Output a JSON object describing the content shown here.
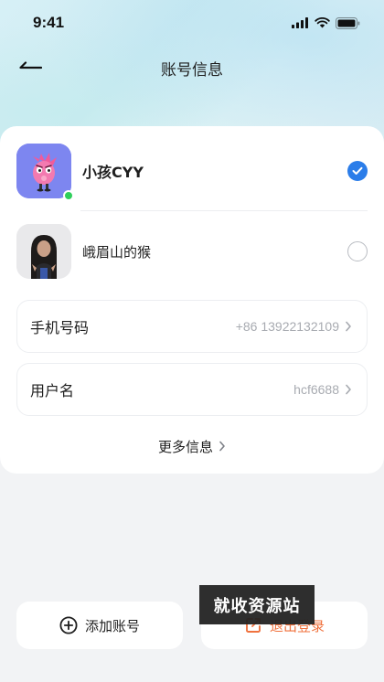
{
  "status_bar": {
    "time": "9:41"
  },
  "header": {
    "title": "账号信息",
    "back_icon": "back-arrow-icon"
  },
  "accounts": [
    {
      "name": "小孩CYY",
      "selected": true,
      "online": true
    },
    {
      "name": "峨眉山的猴",
      "selected": false,
      "online": false
    }
  ],
  "fields": [
    {
      "label": "手机号码",
      "value": "+86 13922132109"
    },
    {
      "label": "用户名",
      "value": "hcf6688"
    }
  ],
  "more_info": {
    "label": "更多信息"
  },
  "actions": {
    "add_label": "添加账号",
    "logout_label": "退出登录"
  },
  "watermark": {
    "text": "就收资源站"
  },
  "colors": {
    "accent": "#2b7de9",
    "online": "#2fcf5b",
    "logout": "#f0723e",
    "avatar_bg": "#7d86f0"
  }
}
